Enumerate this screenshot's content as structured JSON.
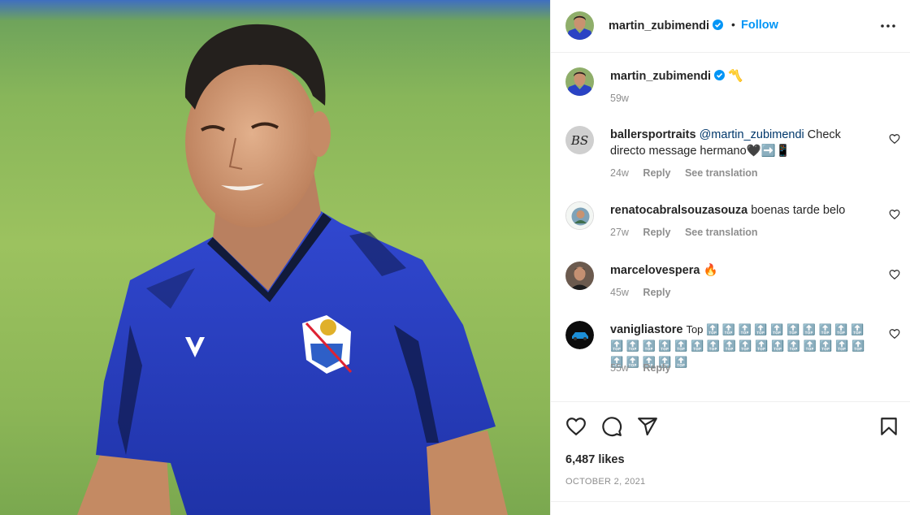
{
  "post": {
    "author": "martin_zubimendi",
    "follow_label": "Follow",
    "separator": "•",
    "caption": {
      "username": "martin_zubimendi",
      "text": "〽️",
      "time": "59w"
    },
    "likes": "6,487 likes",
    "date": "OCTOBER 2, 2021"
  },
  "comments": [
    {
      "username": "ballersportraits",
      "mention": "@martin_zubimendi",
      "text": " Check directo message hermano🖤➡️📱",
      "time": "24w",
      "reply": "Reply",
      "translate": "See translation",
      "avatar_text": "BS"
    },
    {
      "username": "renatocabralsouzasouza",
      "mention": "",
      "text": "boenas tarde belo",
      "time": "27w",
      "reply": "Reply",
      "translate": "See translation"
    },
    {
      "username": "marcelovespera",
      "mention": "",
      "text": "🔥",
      "time": "45w",
      "reply": "Reply",
      "translate": ""
    },
    {
      "username": "vanigliastore",
      "mention": "",
      "text": "Top 🔝 🔝 🔝 🔝 🔝 🔝 🔝 🔝 🔝 🔝 🔝 🔝 🔝 🔝 🔝 🔝 🔝 🔝 🔝 🔝 🔝 🔝 🔝 🔝 🔝 🔝 🔝 🔝 🔝 🔝 🔝",
      "time": "55w",
      "reply": "Reply",
      "translate": ""
    }
  ],
  "colors": {
    "link_blue": "#0095f6",
    "mention_blue": "#00376b",
    "muted": "#8e8e8e",
    "jersey": "#2a43c4"
  },
  "icons": [
    "verified-icon",
    "more-icon",
    "heart-icon",
    "comment-icon",
    "share-icon",
    "bookmark-icon"
  ]
}
